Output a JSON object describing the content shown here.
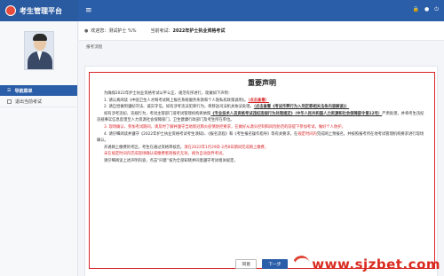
{
  "header": {
    "brand_title": "考生管理平台",
    "menu_toggle": "≡",
    "icons": [
      "lock-icon",
      "user-icon",
      "logout-icon"
    ],
    "colors": {
      "topbar": "#2b5ea8",
      "accent_red": "#d9262a"
    }
  },
  "sidebar": {
    "nav_header": "导航菜单",
    "items": [
      {
        "label": "退出当前考试"
      }
    ]
  },
  "welcome": {
    "greeting": "欢迎您：",
    "user": "测试护士 %%",
    "exam_prefix": "当前考试：",
    "exam": "2022年护士执业资格考试"
  },
  "breadcrumb": "报考流程",
  "notice": {
    "title": "重要声明",
    "intro": "为确保2022年护士执业资格考试公平公正、规范有序进行，现做如下声明：",
    "p1_a": "1. 请认真阅读《中国卫生人才网考试网上报名系统服务条款和个人隐私权政策说明》。",
    "p1_b": "（点击查看）",
    "p2_a": "2. 请自觉做到遵纪守法、诚实守信。如有涉考违法犯罪行为，将移送司法机关依法处理。",
    "p2_b": "（点击查看《考试作弊行为入刑定罪相关法条内容解读》）",
    "p3_a": "如有涉考违纪、违规行为，考试主管部门或考试管理机构将依照",
    "p3_b": "《专业技术人员资格考试违纪违规行为处理规定》（中华人民共和国人力资源和社会保障部令第12号）",
    "p3_c": "严肃处理，并将考生违纪违规事实信息反馈至人力资源社会保障部门、卫生健康行政部门及考生所在单位。",
    "p4": "3. 现场确认、参加考试期间，请及时了解并遵守当地新冠肺炎疫情防控要求，在做好从源头控制和风险防范的前提下参加考试，做好个人防护。",
    "p5_a": "4. 请仔细阅读并遵守《2022年护士执业资格考试考生须知》、《报名流程》和《考生报名操作指导》等有关要求，在",
    "p5_b": "规定时间内",
    "p5_c": "完成网上预报名，并按照报考所在地考试管理机构要求进行现场确认。",
    "p6_a": "开通网上缴费的考区，考生在通过资格审核后，",
    "p6_b": "须在2022年1月29日-2月8日期间完成网上缴费，",
    "p7": "未在规定时间内完成现场确认或缴费者则报名无效，视为自动放弃考试。",
    "p8": "请仔细阅读上述声明内容，点击“同意”按为全部知晓并同意遵守考试相关规定。"
  },
  "buttons": {
    "back": "同意",
    "next": "下一步"
  },
  "watermark": "www.sjzbet.com"
}
